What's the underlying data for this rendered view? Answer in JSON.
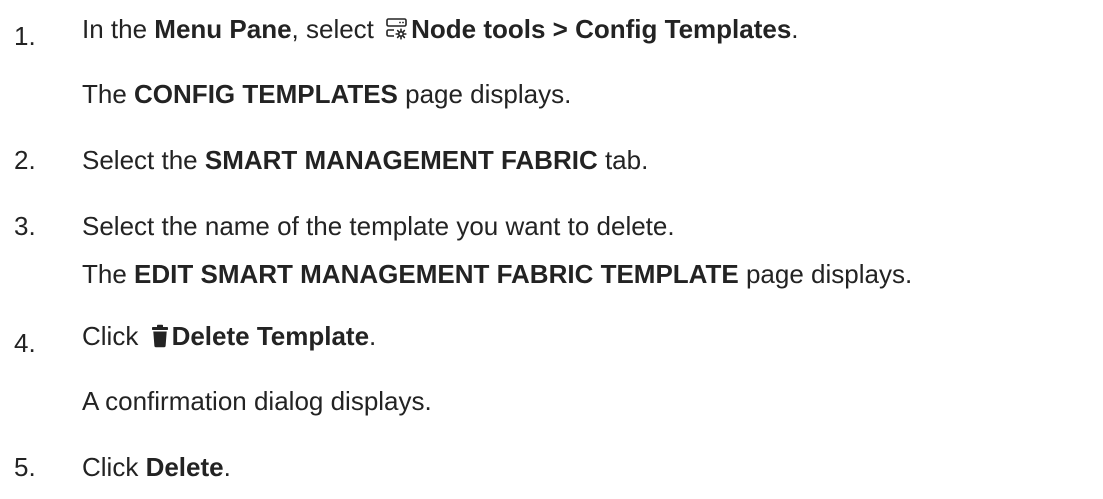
{
  "steps": [
    {
      "number": "1.",
      "main": {
        "prefix": "In the ",
        "menu_pane": "Menu Pane",
        "select_text": ", select ",
        "icon": "node-tools-icon",
        "menu_path": "Node tools > Config Templates",
        "suffix": "."
      },
      "result": {
        "prefix": "The ",
        "page_name": "CONFIG TEMPLATES",
        "suffix": " page displays."
      }
    },
    {
      "number": "2.",
      "main": {
        "prefix": "Select the ",
        "tab_name": "SMART MANAGEMENT FABRIC",
        "suffix": " tab."
      }
    },
    {
      "number": "3.",
      "main": {
        "text": "Select the name of the template you want to delete."
      },
      "result": {
        "prefix": "The ",
        "page_name": "EDIT SMART MANAGEMENT FABRIC TEMPLATE",
        "suffix": " page displays."
      }
    },
    {
      "number": "4.",
      "main": {
        "prefix": "Click ",
        "icon": "trash-icon",
        "button": "Delete Template",
        "suffix": "."
      },
      "result": {
        "text": "A confirmation dialog displays."
      }
    },
    {
      "number": "5.",
      "main": {
        "prefix": "Click ",
        "button": "Delete",
        "suffix": "."
      }
    }
  ],
  "colors": {
    "text": "#232323",
    "background": "#ffffff"
  }
}
